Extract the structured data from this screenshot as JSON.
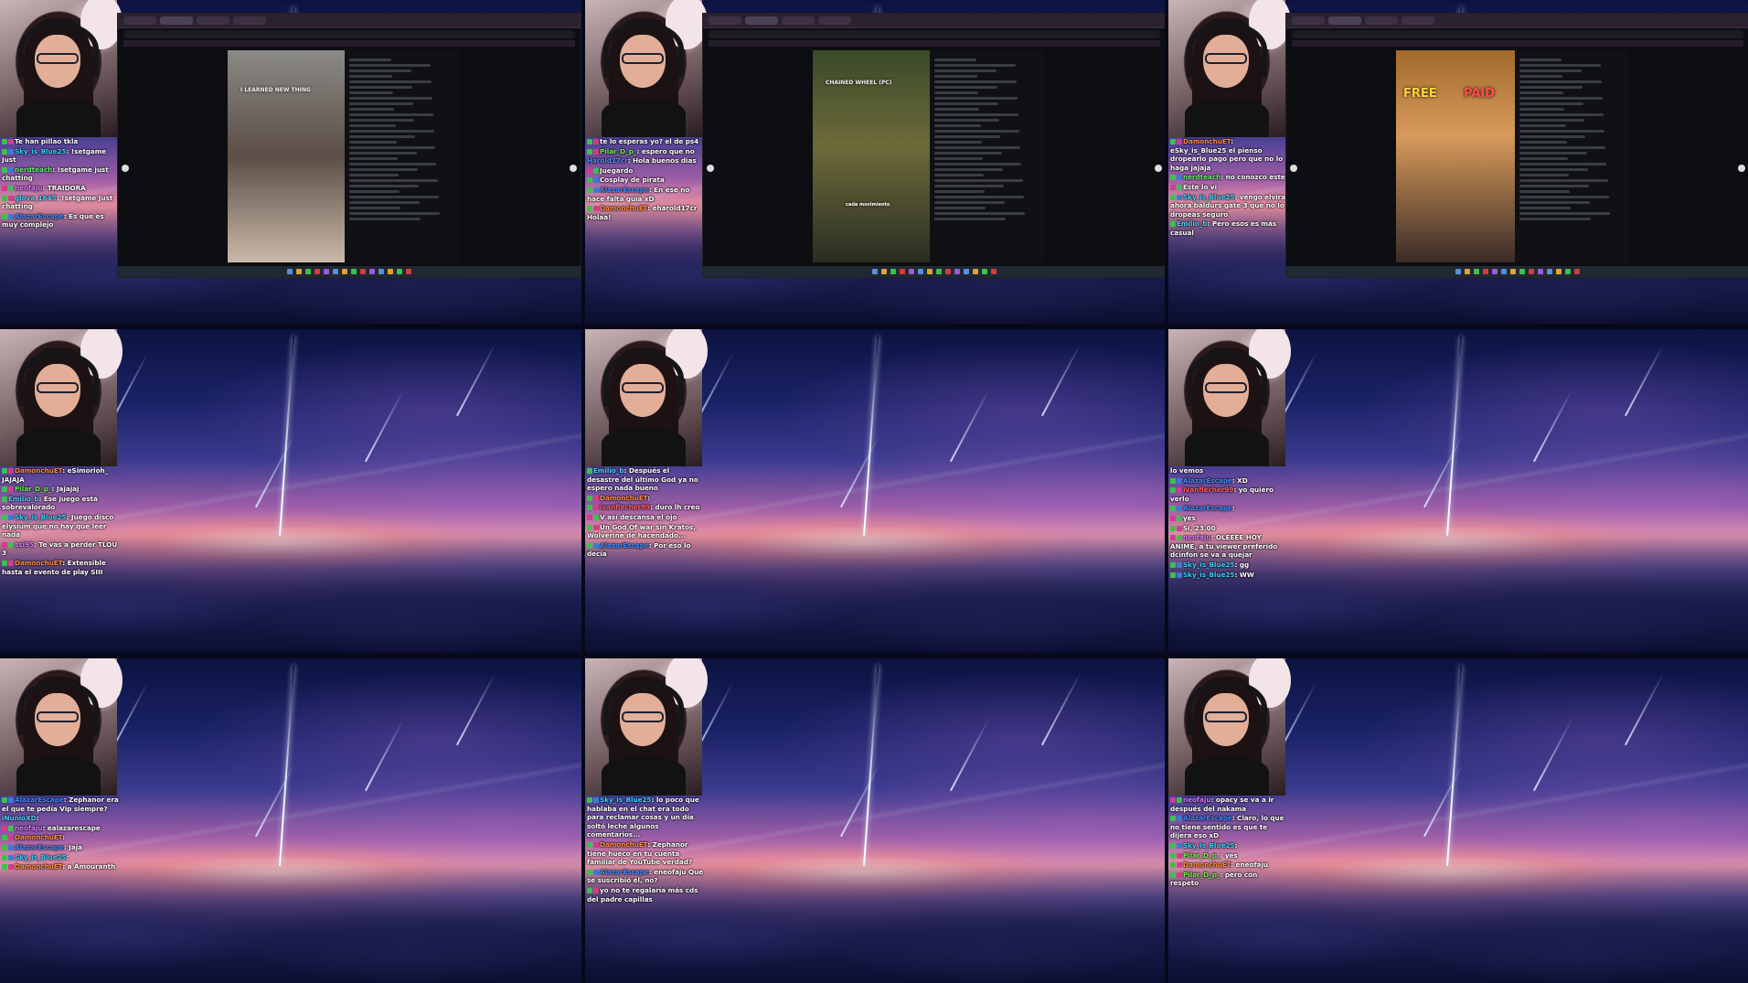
{
  "panels": [
    {
      "has_screen": true,
      "media_caption": "I LEARNED NEW THING",
      "chat": [
        {
          "user": "",
          "color": "#ff5c5c",
          "badges": [
            "b1",
            "b3"
          ],
          "text": "Te han pillao tkla"
        },
        {
          "user": "Sky_is_Blue25",
          "color": "#33d2ff",
          "badges": [
            "b1",
            "b2"
          ],
          "text": "!setgame Just"
        },
        {
          "user": "nerdteach",
          "color": "#5af06a",
          "badges": [
            "b1",
            "b2"
          ],
          "text": "!setgame just chatting"
        },
        {
          "user": "neofaju",
          "color": "#d87cff",
          "badges": [
            "b3",
            "b1"
          ],
          "text": "TRAIDORA"
        },
        {
          "user": "glova_1645",
          "color": "#4fd0ff",
          "badges": [
            "b1",
            "b3"
          ],
          "text": "!setgame Just chatting"
        },
        {
          "user": "AlazarEscape",
          "color": "#3a8cff",
          "badges": [
            "b1",
            "b2"
          ],
          "text": "Es que es muy complejo"
        }
      ]
    },
    {
      "has_screen": true,
      "media_caption": "CHAINED WHEEL (PC)",
      "media_sub": "cada movimiento",
      "chat": [
        {
          "user": "",
          "color": "#ff5c5c",
          "badges": [
            "b1",
            "b3"
          ],
          "text": "te lo esperas yo? el de ps4"
        },
        {
          "user": "Pilar_D_p_",
          "color": "#6af04a",
          "badges": [
            "b1",
            "b3"
          ],
          "text": "espero que no"
        },
        {
          "user": "Harold17cr",
          "color": "#4f8cff",
          "badges": [],
          "text": "Hola buenos dias"
        },
        {
          "user": "",
          "color": "#d87cff",
          "badges": [
            "b3",
            "b1"
          ],
          "text": "Juegardo"
        },
        {
          "user": "",
          "color": "#4fd0ff",
          "badges": [
            "b1",
            "b2"
          ],
          "text": "Cosplay de pirata"
        },
        {
          "user": "AlazarEscape",
          "color": "#3a8cff",
          "badges": [
            "b1",
            "b2"
          ],
          "text": "En ese no hace falta guia xD"
        },
        {
          "user": "DamonchuET",
          "color": "#ff8a3a",
          "badges": [
            "b1",
            "b3"
          ],
          "text": "eharold17cr Holaa!"
        }
      ]
    },
    {
      "has_screen": true,
      "media_caption": "FREE",
      "media_caption2": "PAID",
      "chat": [
        {
          "user": "DamonchuET",
          "color": "#ff8a3a",
          "badges": [
            "b1",
            "b3"
          ],
          "text": "eSky_is_Blue25 el pienso dropearlo pago pero que no lo haga jajaja"
        },
        {
          "user": "nerdteach",
          "color": "#5af06a",
          "badges": [
            "b1",
            "b2"
          ],
          "text": "no conozco este"
        },
        {
          "user": "",
          "color": "#d87cff",
          "badges": [
            "b3",
            "b1"
          ],
          "text": "Este lo vi"
        },
        {
          "user": "Sky_is_Blue25",
          "color": "#33d2ff",
          "badges": [
            "b1",
            "b2"
          ],
          "text": "vengo elvira ahora baldurs gate 3 que no lo dropeas seguro"
        },
        {
          "user": "Emilio_b",
          "color": "#4fd0ff",
          "badges": [
            "b1"
          ],
          "text": "Pero esos es más casual"
        }
      ]
    },
    {
      "has_screen": false,
      "chat": [
        {
          "user": "DamonchuET",
          "color": "#ff8a3a",
          "badges": [
            "b1",
            "b3"
          ],
          "text": "eSimorioh_ JAJAJA"
        },
        {
          "user": "Pilar_D_p_",
          "color": "#6af04a",
          "badges": [
            "b1",
            "b3"
          ],
          "text": "Jajajaj"
        },
        {
          "user": "Emilio_b",
          "color": "#4fd0ff",
          "badges": [
            "b1"
          ],
          "text": "Ese juego está sobrevalorado"
        },
        {
          "user": "Sky_is_Blue25",
          "color": "#33d2ff",
          "badges": [
            "b1",
            "b2"
          ],
          "text": "Juego disco elysium que no hay que leer nada"
        },
        {
          "user": "ssi95",
          "color": "#d87cff",
          "badges": [
            "b3",
            "b1"
          ],
          "text": "Te vas a perder TLOU 3"
        },
        {
          "user": "DamonchuET",
          "color": "#ff8a3a",
          "badges": [
            "b1",
            "b3"
          ],
          "text": "Extensible hasta el evento de play SIII"
        }
      ]
    },
    {
      "has_screen": false,
      "chat": [
        {
          "user": "Emilio_b",
          "color": "#4fd0ff",
          "badges": [
            "b1"
          ],
          "text": "Después el desastre del último God ya no espero nada bueno"
        },
        {
          "user": "DamonchuET",
          "color": "#ff8a3a",
          "badges": [
            "b1",
            "b3"
          ],
          "text": ""
        },
        {
          "user": "ivanflecher99",
          "color": "#ff5c5c",
          "badges": [
            "b1",
            "b3"
          ],
          "text": "duro lh creo"
        },
        {
          "user": "",
          "color": "#d87cff",
          "badges": [
            "b3",
            "b1"
          ],
          "text": "V así descansa el ojo"
        },
        {
          "user": "",
          "color": "#ff5c5c",
          "badges": [
            "b1",
            "b3"
          ],
          "text": "Un God Of war sin Kratos, Wolverine de hacendado..."
        },
        {
          "user": "AlazarEscape",
          "color": "#3a8cff",
          "badges": [
            "b1",
            "b2"
          ],
          "text": "Por eso lo decía"
        }
      ]
    },
    {
      "has_screen": false,
      "chat": [
        {
          "user": "",
          "color": "#ffffff",
          "badges": [],
          "text": "lo vemos"
        },
        {
          "user": "AlazarEscape",
          "color": "#3a8cff",
          "badges": [
            "b1",
            "b2"
          ],
          "text": "XD"
        },
        {
          "user": "Ivanflecher99",
          "color": "#ff5c5c",
          "badges": [
            "b1",
            "b3"
          ],
          "text": "yo quiero verlo"
        },
        {
          "user": "AlazarEscape",
          "color": "#3a8cff",
          "badges": [
            "b1",
            "b2"
          ],
          "text": ""
        },
        {
          "user": "",
          "color": "#d87cff",
          "badges": [
            "b3",
            "b1"
          ],
          "text": "yes"
        },
        {
          "user": "",
          "color": "#ff5c5c",
          "badges": [
            "b1",
            "b3"
          ],
          "text": "Sí, 23.00"
        },
        {
          "user": "neofaju",
          "color": "#d87cff",
          "badges": [
            "b3",
            "b1"
          ],
          "text": "OLEEEE HOY ANIME, a tu viewer preferido dcinfon se va a quejar"
        },
        {
          "user": "Sky_is_Blue25",
          "color": "#33d2ff",
          "badges": [
            "b1",
            "b2"
          ],
          "text": "gg"
        },
        {
          "user": "Sky_is_Blue25",
          "color": "#33d2ff",
          "badges": [
            "b1",
            "b2"
          ],
          "text": "WW"
        }
      ]
    },
    {
      "has_screen": false,
      "chat": [
        {
          "user": "AlazarEscape",
          "color": "#3a8cff",
          "badges": [
            "b1",
            "b2"
          ],
          "text": "Zephanor era el que te pedía Vip siempre?"
        },
        {
          "user": "iNunioXD",
          "color": "#4fd0ff",
          "badges": [],
          "text": ""
        },
        {
          "user": "neofaju",
          "color": "#d87cff",
          "badges": [
            "b3",
            "b1"
          ],
          "text": "ealazarescape"
        },
        {
          "user": "DamonchuET",
          "color": "#ff8a3a",
          "badges": [
            "b1",
            "b3"
          ],
          "text": ""
        },
        {
          "user": "AlazarEscape",
          "color": "#3a8cff",
          "badges": [
            "b1",
            "b2"
          ],
          "text": "Jaja"
        },
        {
          "user": "Sky_is_Blue25",
          "color": "#33d2ff",
          "badges": [
            "b1",
            "b2"
          ],
          "text": ""
        },
        {
          "user": "DamonchuET",
          "color": "#ff8a3a",
          "badges": [
            "b1",
            "b3"
          ],
          "text": "a Amouranth"
        }
      ]
    },
    {
      "has_screen": false,
      "chat": [
        {
          "user": "Sky_is_Blue25",
          "color": "#33d2ff",
          "badges": [
            "b1",
            "b2"
          ],
          "text": "lo poco que hablaba en el chat era todo para reclamar cosas y un día soltó leche algunos comentarios..."
        },
        {
          "user": "DamonchuET",
          "color": "#ff8a3a",
          "badges": [
            "b1",
            "b3"
          ],
          "text": "Zephanor tiene hueco en tu cuenta familiar de YouTube verdad?"
        },
        {
          "user": "AlazarEscape",
          "color": "#3a8cff",
          "badges": [
            "b1",
            "b2"
          ],
          "text": "eneofaju Que se suscribió él, no?"
        },
        {
          "user": "",
          "color": "#ff5c5c",
          "badges": [
            "b1",
            "b3"
          ],
          "text": "yo no te regalaría más cds del padre capillas"
        }
      ]
    },
    {
      "has_screen": false,
      "chat": [
        {
          "user": "neofaju",
          "color": "#d87cff",
          "badges": [
            "b3",
            "b1"
          ],
          "text": "opacy se va a ir después del nakama"
        },
        {
          "user": "AlazarEscape",
          "color": "#3a8cff",
          "badges": [
            "b1",
            "b2"
          ],
          "text": "Claro, lo que no tiene sentido es que te dijera eso xD"
        },
        {
          "user": "Sky_is_Blue25",
          "color": "#33d2ff",
          "badges": [
            "b1",
            "b2"
          ],
          "text": ""
        },
        {
          "user": "Pilar_D_p_",
          "color": "#6af04a",
          "badges": [
            "b1",
            "b3"
          ],
          "text": "yes"
        },
        {
          "user": "DamonchuET",
          "color": "#ff8a3a",
          "badges": [
            "b1",
            "b3"
          ],
          "text": "eneofaju"
        },
        {
          "user": "Pilar_D_p_",
          "color": "#6af04a",
          "badges": [
            "b1",
            "b3"
          ],
          "text": "pero con respeto"
        }
      ]
    }
  ]
}
